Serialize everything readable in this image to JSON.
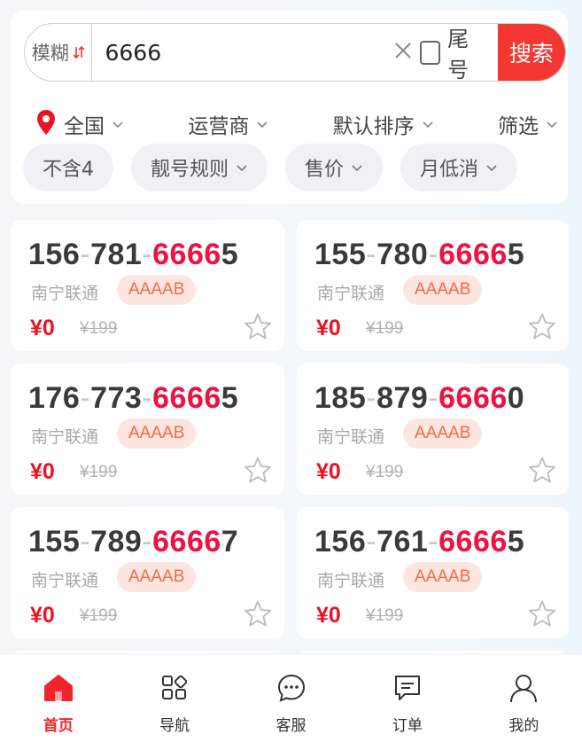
{
  "search": {
    "mode_label": "模糊",
    "query": "6666",
    "tail_label": "尾号",
    "tail_checked": false,
    "button_label": "搜索"
  },
  "filters": [
    {
      "label": "全国",
      "icon": "location-pin-icon"
    },
    {
      "label": "运营商"
    },
    {
      "label": "默认排序"
    },
    {
      "label": "筛选"
    }
  ],
  "chips": [
    {
      "label": "不含4",
      "dropdown": false
    },
    {
      "label": "靓号规则",
      "dropdown": true
    },
    {
      "label": "售价",
      "dropdown": true
    },
    {
      "label": "月低消",
      "dropdown": true
    }
  ],
  "cards": [
    {
      "p1": "156",
      "p2": "781",
      "hl": "6666",
      "tail": "5",
      "carrier": "南宁联通",
      "tag": "AAAAB",
      "price": "¥0",
      "orig": "¥199"
    },
    {
      "p1": "155",
      "p2": "780",
      "hl": "6666",
      "tail": "5",
      "carrier": "南宁联通",
      "tag": "AAAAB",
      "price": "¥0",
      "orig": "¥199"
    },
    {
      "p1": "176",
      "p2": "773",
      "hl": "6666",
      "tail": "5",
      "carrier": "南宁联通",
      "tag": "AAAAB",
      "price": "¥0",
      "orig": "¥199"
    },
    {
      "p1": "185",
      "p2": "879",
      "hl": "6666",
      "tail": "0",
      "carrier": "南宁联通",
      "tag": "AAAAB",
      "price": "¥0",
      "orig": "¥199"
    },
    {
      "p1": "155",
      "p2": "789",
      "hl": "6666",
      "tail": "7",
      "carrier": "南宁联通",
      "tag": "AAAAB",
      "price": "¥0",
      "orig": "¥199"
    },
    {
      "p1": "156",
      "p2": "761",
      "hl": "6666",
      "tail": "5",
      "carrier": "南宁联通",
      "tag": "AAAAB",
      "price": "¥0",
      "orig": "¥199"
    }
  ],
  "nav": [
    {
      "label": "首页",
      "icon": "home-icon",
      "active": true
    },
    {
      "label": "导航",
      "icon": "grid-apps-icon",
      "active": false
    },
    {
      "label": "客服",
      "icon": "chat-bubble-icon",
      "active": false
    },
    {
      "label": "订单",
      "icon": "order-message-icon",
      "active": false
    },
    {
      "label": "我的",
      "icon": "user-icon",
      "active": false
    }
  ],
  "colors": {
    "accent": "#f43733",
    "highlight": "#ee1144",
    "tag_bg": "#fde6df",
    "tag_text": "#ef6b45"
  }
}
